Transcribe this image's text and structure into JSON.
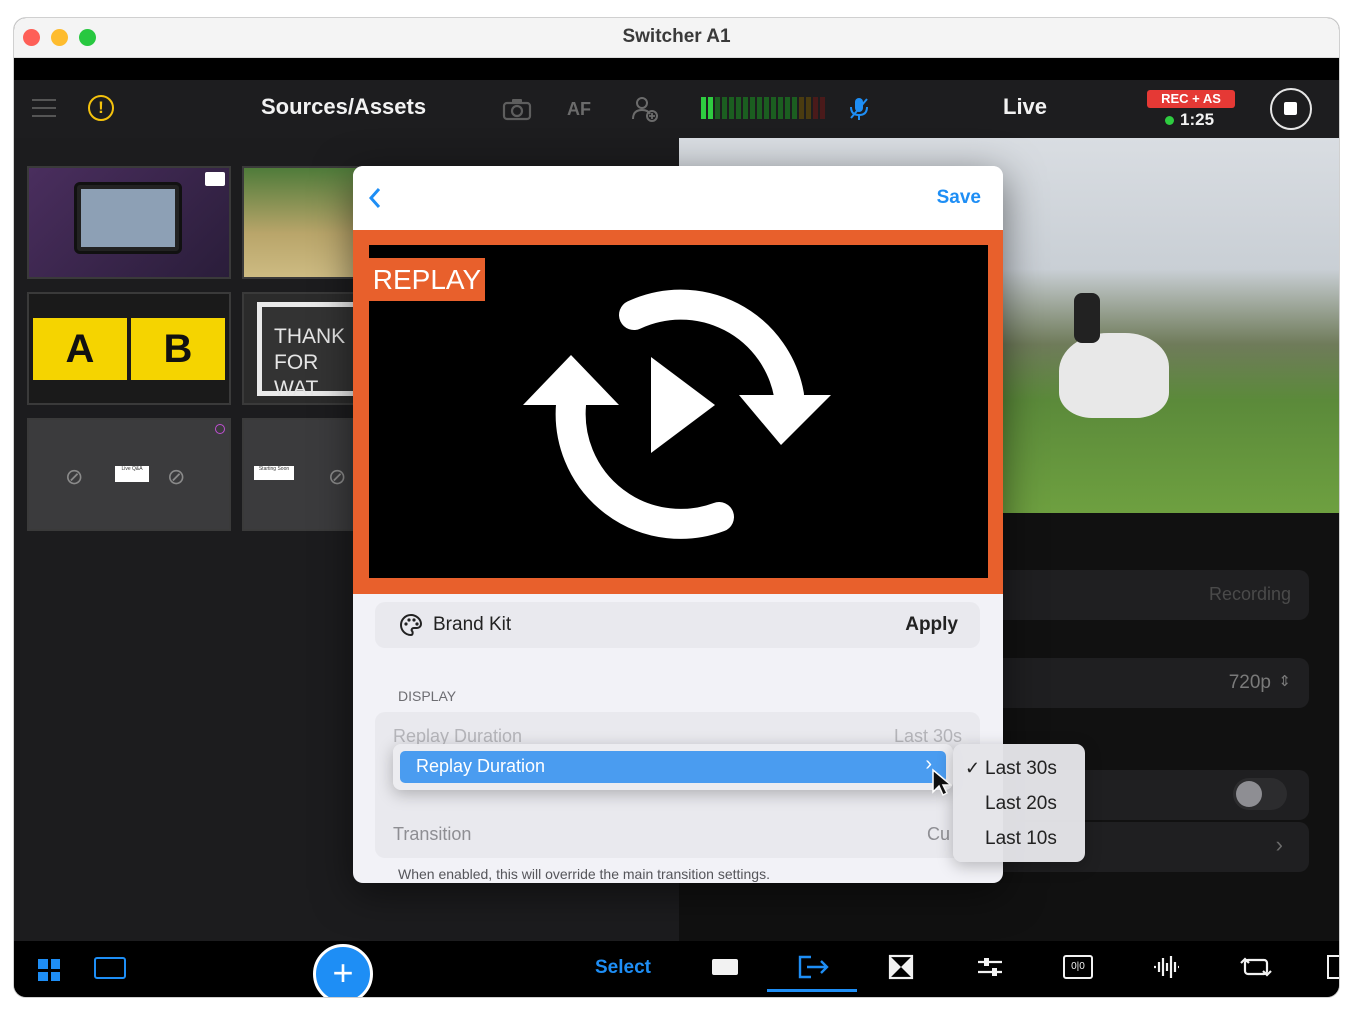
{
  "window": {
    "title": "Switcher A1"
  },
  "toolbar": {
    "sources_title": "Sources/Assets",
    "af_label": "AF",
    "live_title": "Live",
    "rec_badge": "REC + AS",
    "timer": "1:25"
  },
  "sources": {
    "thumb_ab": {
      "left": "A",
      "right": "B"
    },
    "thumb_thanks": {
      "line1": "THANK",
      "line2": "FOR WAT"
    },
    "thumb_live_qa": "Live Q&A",
    "thumb_starting_soon": "Starting Soon"
  },
  "modal": {
    "save_label": "Save",
    "replay_badge": "REPLAY",
    "brand_kit_label": "Brand Kit",
    "apply_label": "Apply",
    "display_header": "DISPLAY",
    "replay_duration_label": "Replay Duration",
    "replay_duration_value": "Last 30s",
    "transition_label": "Transition",
    "transition_value": "Cu",
    "footnote": "When enabled, this will override the main transition settings."
  },
  "menu": {
    "item_label": "Replay Duration",
    "options": [
      {
        "label": "Last 30s",
        "checked": true
      },
      {
        "label": "Last 20s",
        "checked": false
      },
      {
        "label": "Last 10s",
        "checked": false
      }
    ]
  },
  "right_panel": {
    "recording_label": "Recording",
    "resolution_label": "720p"
  },
  "bottom_bar": {
    "select_label": "Select"
  },
  "colors": {
    "accent_blue": "#1e8ef5",
    "replay_orange": "#e8602c",
    "rec_red": "#e53935",
    "menu_highlight": "#4a9cf0"
  }
}
